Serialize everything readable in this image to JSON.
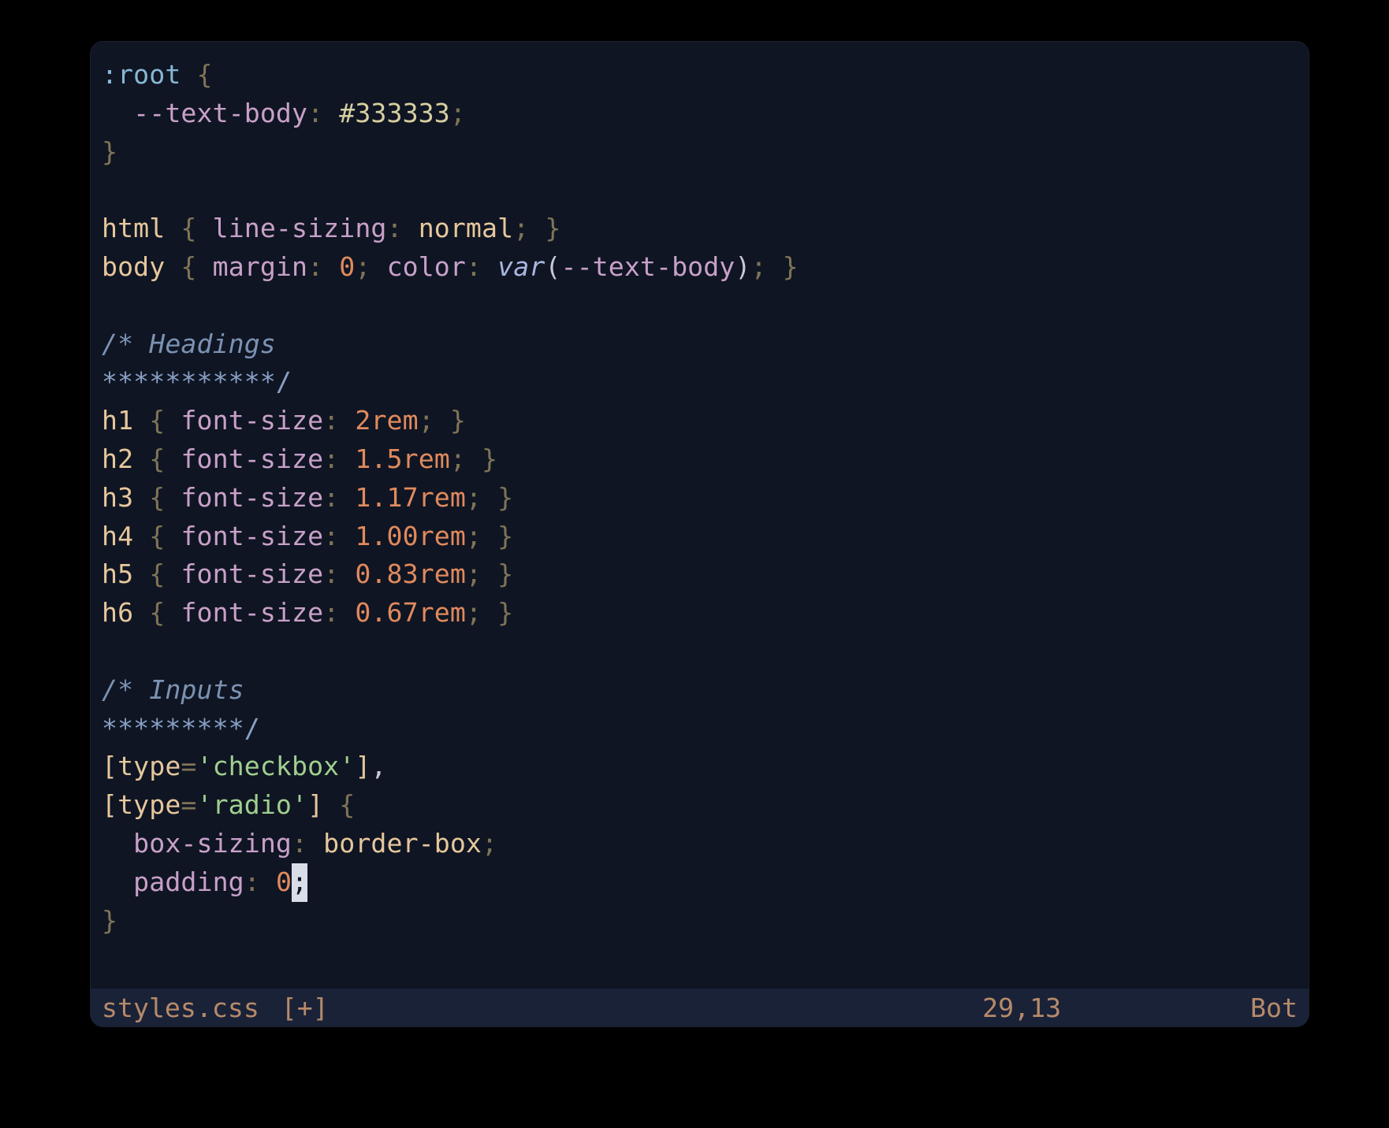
{
  "status": {
    "filename": "styles.css",
    "modified_marker": "[+]",
    "position": "29,13",
    "scroll": "Bot"
  },
  "code": {
    "lines": [
      {
        "tokens": [
          {
            "cls": "c-pseudo",
            "t": ":root"
          },
          {
            "cls": "c-default",
            "t": " "
          },
          {
            "cls": "c-punct",
            "t": "{"
          }
        ]
      },
      {
        "tokens": [
          {
            "cls": "c-default",
            "t": "  "
          },
          {
            "cls": "c-property",
            "t": "--text-body"
          },
          {
            "cls": "c-punct",
            "t": ":"
          },
          {
            "cls": "c-default",
            "t": " "
          },
          {
            "cls": "c-hash",
            "t": "#333333"
          },
          {
            "cls": "c-punct",
            "t": ";"
          }
        ]
      },
      {
        "tokens": [
          {
            "cls": "c-punct",
            "t": "}"
          }
        ]
      },
      {
        "tokens": [
          {
            "cls": "c-default",
            "t": ""
          }
        ]
      },
      {
        "tokens": [
          {
            "cls": "c-keyword",
            "t": "html"
          },
          {
            "cls": "c-default",
            "t": " "
          },
          {
            "cls": "c-punct",
            "t": "{"
          },
          {
            "cls": "c-default",
            "t": " "
          },
          {
            "cls": "c-property",
            "t": "line-sizing"
          },
          {
            "cls": "c-punct",
            "t": ":"
          },
          {
            "cls": "c-default",
            "t": " "
          },
          {
            "cls": "c-keyword",
            "t": "normal"
          },
          {
            "cls": "c-punct",
            "t": ";"
          },
          {
            "cls": "c-default",
            "t": " "
          },
          {
            "cls": "c-punct",
            "t": "}"
          }
        ]
      },
      {
        "tokens": [
          {
            "cls": "c-keyword",
            "t": "body"
          },
          {
            "cls": "c-default",
            "t": " "
          },
          {
            "cls": "c-punct",
            "t": "{"
          },
          {
            "cls": "c-default",
            "t": " "
          },
          {
            "cls": "c-property",
            "t": "margin"
          },
          {
            "cls": "c-punct",
            "t": ":"
          },
          {
            "cls": "c-default",
            "t": " "
          },
          {
            "cls": "c-number",
            "t": "0"
          },
          {
            "cls": "c-punct",
            "t": ";"
          },
          {
            "cls": "c-default",
            "t": " "
          },
          {
            "cls": "c-property",
            "t": "color"
          },
          {
            "cls": "c-punct",
            "t": ":"
          },
          {
            "cls": "c-default",
            "t": " "
          },
          {
            "cls": "c-var",
            "t": "var"
          },
          {
            "cls": "c-default",
            "t": "("
          },
          {
            "cls": "c-property",
            "t": "--text-body"
          },
          {
            "cls": "c-default",
            "t": ")"
          },
          {
            "cls": "c-punct",
            "t": ";"
          },
          {
            "cls": "c-default",
            "t": " "
          },
          {
            "cls": "c-punct",
            "t": "}"
          }
        ]
      },
      {
        "tokens": [
          {
            "cls": "c-default",
            "t": ""
          }
        ]
      },
      {
        "tokens": [
          {
            "cls": "c-comment",
            "t": "/* Headings"
          }
        ]
      },
      {
        "tokens": [
          {
            "cls": "c-comment-ast",
            "t": "***********/"
          }
        ]
      },
      {
        "tokens": [
          {
            "cls": "c-keyword",
            "t": "h1"
          },
          {
            "cls": "c-default",
            "t": " "
          },
          {
            "cls": "c-punct",
            "t": "{"
          },
          {
            "cls": "c-default",
            "t": " "
          },
          {
            "cls": "c-property",
            "t": "font-size"
          },
          {
            "cls": "c-punct",
            "t": ":"
          },
          {
            "cls": "c-default",
            "t": " "
          },
          {
            "cls": "c-number",
            "t": "2rem"
          },
          {
            "cls": "c-punct",
            "t": ";"
          },
          {
            "cls": "c-default",
            "t": " "
          },
          {
            "cls": "c-punct",
            "t": "}"
          }
        ]
      },
      {
        "tokens": [
          {
            "cls": "c-keyword",
            "t": "h2"
          },
          {
            "cls": "c-default",
            "t": " "
          },
          {
            "cls": "c-punct",
            "t": "{"
          },
          {
            "cls": "c-default",
            "t": " "
          },
          {
            "cls": "c-property",
            "t": "font-size"
          },
          {
            "cls": "c-punct",
            "t": ":"
          },
          {
            "cls": "c-default",
            "t": " "
          },
          {
            "cls": "c-number",
            "t": "1.5rem"
          },
          {
            "cls": "c-punct",
            "t": ";"
          },
          {
            "cls": "c-default",
            "t": " "
          },
          {
            "cls": "c-punct",
            "t": "}"
          }
        ]
      },
      {
        "tokens": [
          {
            "cls": "c-keyword",
            "t": "h3"
          },
          {
            "cls": "c-default",
            "t": " "
          },
          {
            "cls": "c-punct",
            "t": "{"
          },
          {
            "cls": "c-default",
            "t": " "
          },
          {
            "cls": "c-property",
            "t": "font-size"
          },
          {
            "cls": "c-punct",
            "t": ":"
          },
          {
            "cls": "c-default",
            "t": " "
          },
          {
            "cls": "c-number",
            "t": "1.17rem"
          },
          {
            "cls": "c-punct",
            "t": ";"
          },
          {
            "cls": "c-default",
            "t": " "
          },
          {
            "cls": "c-punct",
            "t": "}"
          }
        ]
      },
      {
        "tokens": [
          {
            "cls": "c-keyword",
            "t": "h4"
          },
          {
            "cls": "c-default",
            "t": " "
          },
          {
            "cls": "c-punct",
            "t": "{"
          },
          {
            "cls": "c-default",
            "t": " "
          },
          {
            "cls": "c-property",
            "t": "font-size"
          },
          {
            "cls": "c-punct",
            "t": ":"
          },
          {
            "cls": "c-default",
            "t": " "
          },
          {
            "cls": "c-number",
            "t": "1.00rem"
          },
          {
            "cls": "c-punct",
            "t": ";"
          },
          {
            "cls": "c-default",
            "t": " "
          },
          {
            "cls": "c-punct",
            "t": "}"
          }
        ]
      },
      {
        "tokens": [
          {
            "cls": "c-keyword",
            "t": "h5"
          },
          {
            "cls": "c-default",
            "t": " "
          },
          {
            "cls": "c-punct",
            "t": "{"
          },
          {
            "cls": "c-default",
            "t": " "
          },
          {
            "cls": "c-property",
            "t": "font-size"
          },
          {
            "cls": "c-punct",
            "t": ":"
          },
          {
            "cls": "c-default",
            "t": " "
          },
          {
            "cls": "c-number",
            "t": "0.83rem"
          },
          {
            "cls": "c-punct",
            "t": ";"
          },
          {
            "cls": "c-default",
            "t": " "
          },
          {
            "cls": "c-punct",
            "t": "}"
          }
        ]
      },
      {
        "tokens": [
          {
            "cls": "c-keyword",
            "t": "h6"
          },
          {
            "cls": "c-default",
            "t": " "
          },
          {
            "cls": "c-punct",
            "t": "{"
          },
          {
            "cls": "c-default",
            "t": " "
          },
          {
            "cls": "c-property",
            "t": "font-size"
          },
          {
            "cls": "c-punct",
            "t": ":"
          },
          {
            "cls": "c-default",
            "t": " "
          },
          {
            "cls": "c-number",
            "t": "0.67rem"
          },
          {
            "cls": "c-punct",
            "t": ";"
          },
          {
            "cls": "c-default",
            "t": " "
          },
          {
            "cls": "c-punct",
            "t": "}"
          }
        ]
      },
      {
        "tokens": [
          {
            "cls": "c-default",
            "t": ""
          }
        ]
      },
      {
        "tokens": [
          {
            "cls": "c-comment",
            "t": "/* Inputs"
          }
        ]
      },
      {
        "tokens": [
          {
            "cls": "c-comment-ast",
            "t": "*********/"
          }
        ]
      },
      {
        "tokens": [
          {
            "cls": "c-keyword",
            "t": "["
          },
          {
            "cls": "c-keyword",
            "t": "type"
          },
          {
            "cls": "c-punct",
            "t": "="
          },
          {
            "cls": "c-string",
            "t": "'checkbox'"
          },
          {
            "cls": "c-keyword",
            "t": "]"
          },
          {
            "cls": "c-default",
            "t": ","
          }
        ]
      },
      {
        "tokens": [
          {
            "cls": "c-keyword",
            "t": "["
          },
          {
            "cls": "c-keyword",
            "t": "type"
          },
          {
            "cls": "c-punct",
            "t": "="
          },
          {
            "cls": "c-string",
            "t": "'radio'"
          },
          {
            "cls": "c-keyword",
            "t": "]"
          },
          {
            "cls": "c-default",
            "t": " "
          },
          {
            "cls": "c-punct",
            "t": "{"
          }
        ]
      },
      {
        "tokens": [
          {
            "cls": "c-default",
            "t": "  "
          },
          {
            "cls": "c-property",
            "t": "box-sizing"
          },
          {
            "cls": "c-punct",
            "t": ":"
          },
          {
            "cls": "c-default",
            "t": " "
          },
          {
            "cls": "c-keyword",
            "t": "border-box"
          },
          {
            "cls": "c-punct",
            "t": ";"
          }
        ]
      },
      {
        "tokens": [
          {
            "cls": "c-default",
            "t": "  "
          },
          {
            "cls": "c-property",
            "t": "padding"
          },
          {
            "cls": "c-punct",
            "t": ":"
          },
          {
            "cls": "c-default",
            "t": " "
          },
          {
            "cls": "c-number",
            "t": "0"
          },
          {
            "cls": "cursor",
            "t": ";"
          }
        ]
      },
      {
        "tokens": [
          {
            "cls": "c-punct",
            "t": "}"
          }
        ]
      }
    ]
  }
}
